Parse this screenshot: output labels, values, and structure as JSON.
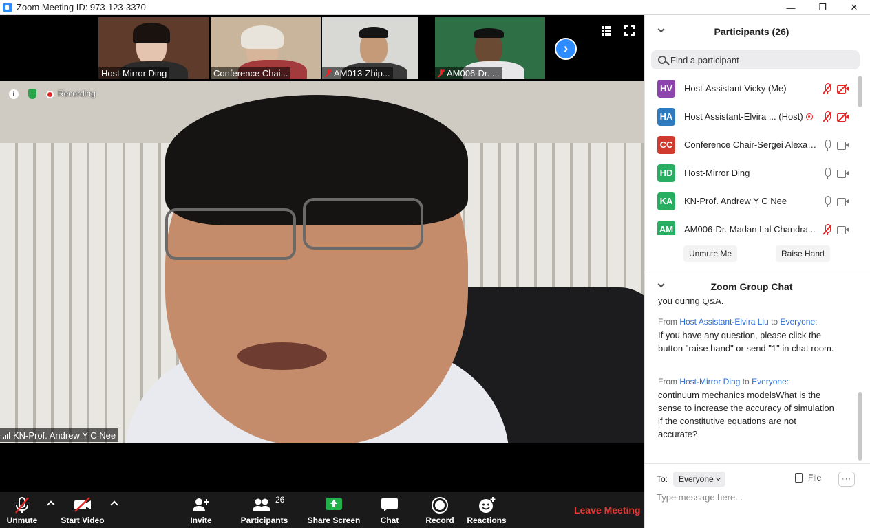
{
  "window": {
    "title": "Zoom Meeting ID: 973-123-3370",
    "controls": [
      "—",
      "❐",
      "✕"
    ]
  },
  "thumbnails": [
    {
      "label": "Host-Mirror Ding",
      "muted": false,
      "colors": {
        "bg": "#5e3b2a",
        "face": "#e4c4ae",
        "body": "#2b2b2b",
        "hair": "#1a120e"
      }
    },
    {
      "label": "Conference Chai...",
      "muted": false,
      "colors": {
        "bg": "#c9b59c",
        "face": "#d7b59a",
        "body": "#a33a3c",
        "hair": "#e8e4dc"
      }
    },
    {
      "label": "AM013-Zhip...",
      "muted": true,
      "colors": {
        "bg": "#d8d8d4",
        "face": "#c49a78",
        "body": "#3a3a3a",
        "hair": "#151515"
      }
    },
    {
      "label": "AM006-Dr. ...",
      "muted": true,
      "colors": {
        "bg": "#2f6f46",
        "face": "#6b4a34",
        "body": "#e7e7ea",
        "hair": "#111111"
      }
    }
  ],
  "main_video": {
    "recording_label": "Recording",
    "speaker_name": "KN-Prof. Andrew Y C Nee"
  },
  "toolbar": {
    "unmute": "Unmute",
    "start_video": "Start Video",
    "invite": "Invite",
    "participants": "Participants",
    "participants_count": "26",
    "share_screen": "Share Screen",
    "chat": "Chat",
    "record": "Record",
    "reactions": "Reactions",
    "leave": "Leave Meeting"
  },
  "participants_panel": {
    "title": "Participants (26)",
    "search_placeholder": "Find a participant",
    "items": [
      {
        "initials": "HV",
        "color": "#8e44ad",
        "name": "Host-Assistant Vicky (Me)",
        "mic": "muted",
        "cam": "off",
        "recording": false
      },
      {
        "initials": "HA",
        "color": "#2e7bbf",
        "name": "Host Assistant-Elvira ... (Host)",
        "mic": "muted",
        "cam": "off",
        "recording": true
      },
      {
        "initials": "CC",
        "color": "#d13a2f",
        "name": "Conference Chair-Sergei Alexan...",
        "mic": "on",
        "cam": "on",
        "recording": false
      },
      {
        "initials": "HD",
        "color": "#27ae60",
        "name": "Host-Mirror Ding",
        "mic": "on",
        "cam": "on",
        "recording": false
      },
      {
        "initials": "KA",
        "color": "#27ae60",
        "name": "KN-Prof. Andrew Y C Nee",
        "mic": "on",
        "cam": "on",
        "recording": false
      },
      {
        "initials": "AM",
        "color": "#27ae60",
        "name": "AM006-Dr.  Madan Lal Chandra...",
        "mic": "muted",
        "cam": "on",
        "recording": false
      }
    ],
    "unmute_me": "Unmute Me",
    "raise_hand": "Raise Hand"
  },
  "chat_panel": {
    "title": "Zoom Group Chat",
    "partial_line": "you during Q&A.",
    "messages": [
      {
        "from_prefix": "From",
        "sender": "Host Assistant-Elvira Liu",
        "to_word": "to",
        "recipient": "Everyone:",
        "text": "If you have any question, please click the button \"raise hand\" or send \"1\" in chat room."
      },
      {
        "from_prefix": "From",
        "sender": "Host-Mirror Ding",
        "to_word": "to",
        "recipient": "Everyone:",
        "text": "continuum mechanics modelsWhat is the sense to increase the accuracy of simulation if the constitutive equations are not accurate?"
      }
    ],
    "to_label": "To:",
    "to_value": "Everyone",
    "file_label": "File",
    "more_label": "···",
    "input_placeholder": "Type message here..."
  }
}
